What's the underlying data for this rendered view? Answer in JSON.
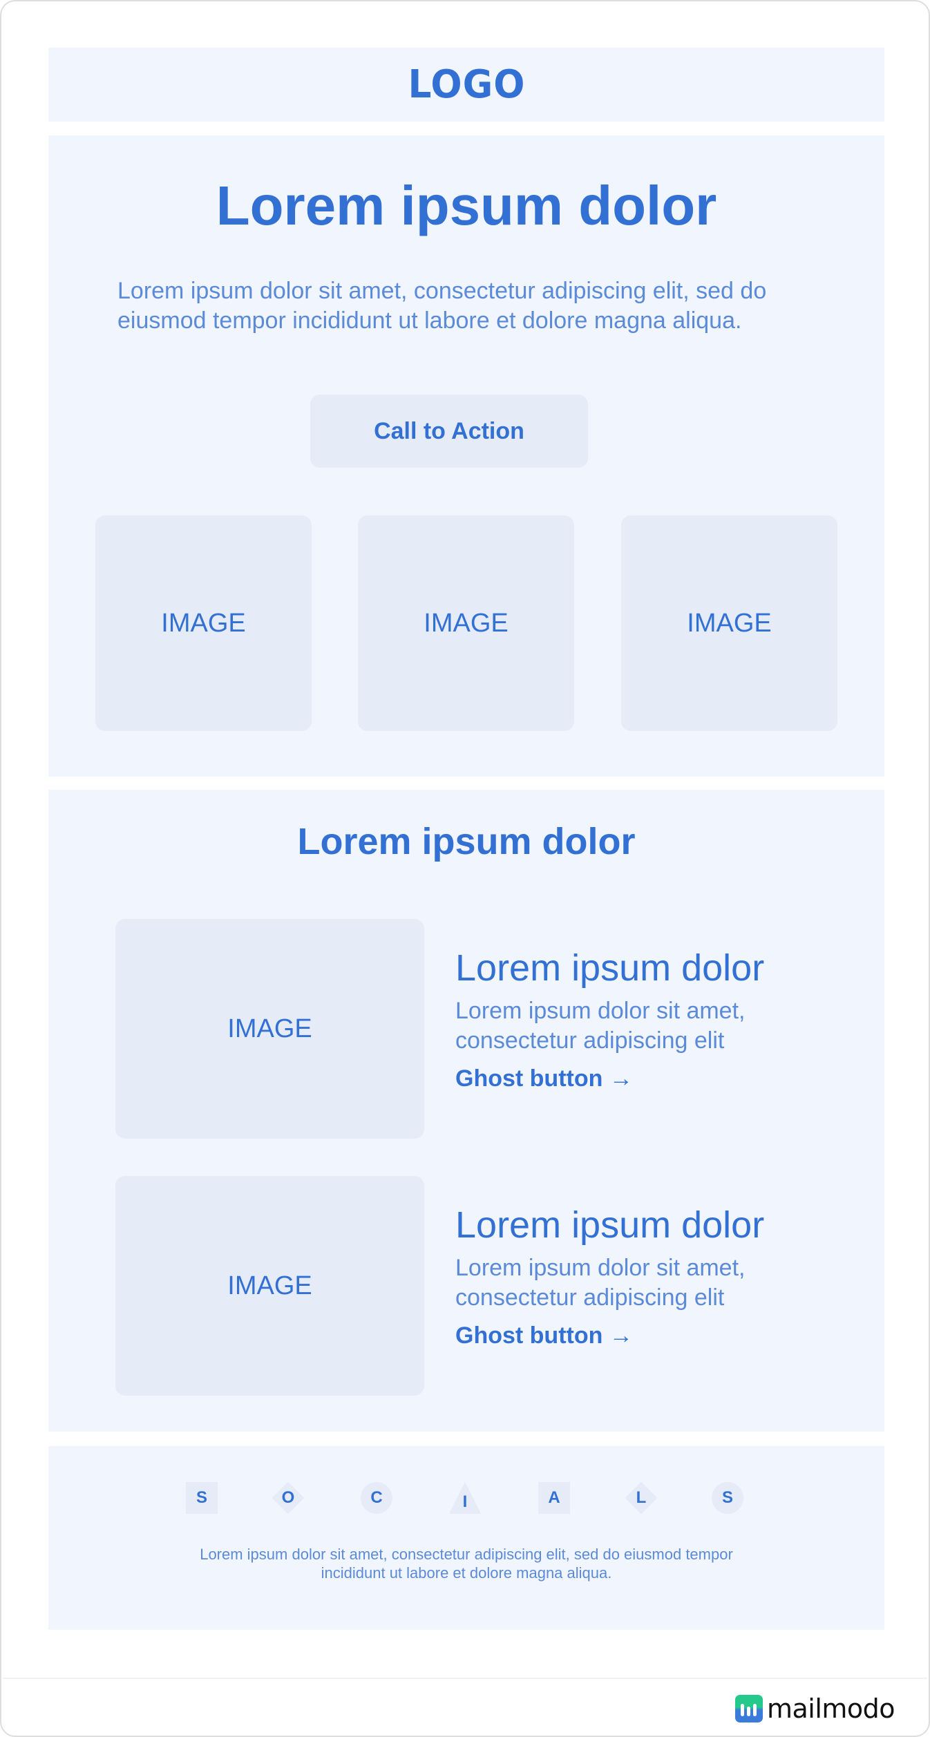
{
  "header": {
    "logo": "LOGO"
  },
  "hero": {
    "title": "Lorem ipsum dolor",
    "paragraph": "Lorem ipsum dolor sit amet, consectetur adipiscing elit, sed do eiusmod tempor incididunt ut labore et dolore magna aliqua.",
    "cta_label": "Call to Action",
    "images": [
      "IMAGE",
      "IMAGE",
      "IMAGE"
    ]
  },
  "features": {
    "title": "Lorem ipsum dolor",
    "rows": [
      {
        "image": "IMAGE",
        "heading": "Lorem ipsum dolor",
        "paragraph": "Lorem ipsum dolor sit amet, consectetur adipiscing elit",
        "ghost_label": "Ghost button →"
      },
      {
        "image": "IMAGE",
        "heading": "Lorem ipsum dolor",
        "paragraph": "Lorem ipsum dolor sit amet, consectetur adipiscing elit",
        "ghost_label": "Ghost button →"
      }
    ]
  },
  "footer": {
    "socials": [
      {
        "letter": "S",
        "shape": "square"
      },
      {
        "letter": "O",
        "shape": "diamond"
      },
      {
        "letter": "C",
        "shape": "circle"
      },
      {
        "letter": "I",
        "shape": "triangle"
      },
      {
        "letter": "A",
        "shape": "square"
      },
      {
        "letter": "L",
        "shape": "diamond"
      },
      {
        "letter": "S",
        "shape": "circle"
      }
    ],
    "text": "Lorem ipsum dolor sit amet, consectetur adipiscing elit, sed do eiusmod tempor incididunt ut labore et dolore magna aliqua."
  },
  "branding": {
    "name": "mailmodo",
    "icon": "mailmodo-logo-icon"
  },
  "colors": {
    "primary": "#3370d4",
    "section_bg": "#f1f5fd",
    "tile_bg": "#e5ecf8",
    "body_text": "#5b8ad9"
  }
}
